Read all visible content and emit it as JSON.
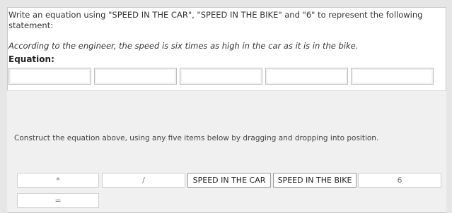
{
  "question": {
    "instruction": "Write an equation using \"SPEED IN THE CAR\", \"SPEED IN THE BIKE\" and \"6\" to represent the following statement:",
    "statement": "According to the engineer, the speed is six times as high in the car as it is in the bike.",
    "equation_label": "Equation:"
  },
  "equation_slots": [
    "",
    "",
    "",
    "",
    ""
  ],
  "construct_note": "Construct the equation above, using any five items below by dragging and dropping into position.",
  "tiles": [
    {
      "label": "*"
    },
    {
      "label": "/"
    },
    {
      "label": "SPEED IN THE CAR"
    },
    {
      "label": "SPEED IN THE BIKE"
    },
    {
      "label": "6"
    },
    {
      "label": "="
    }
  ]
}
